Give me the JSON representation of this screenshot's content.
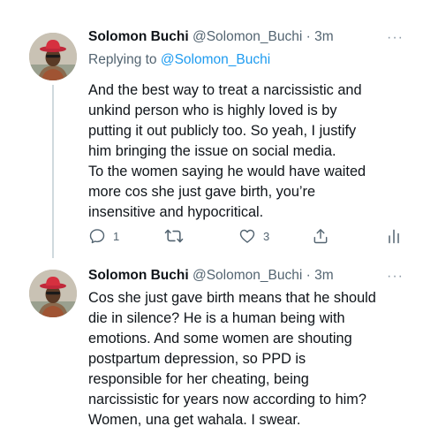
{
  "tweets": [
    {
      "author_name": "Solomon Buchi",
      "handle": "@Solomon_Buchi",
      "separator": "·",
      "time": "3m",
      "more_icon": "more-horizontal-icon",
      "replying_prefix": "Replying to",
      "replying_to": "@Solomon_Buchi",
      "text_lines": [
        "And the best way to treat a narcissistic and",
        "unkind person who is highly loved is by",
        "putting it out publicly too. So yeah, I justify",
        "him bringing the issue on social media.",
        "To the women saying he would have waited",
        "more cos she just gave birth, you’re",
        "insensitive and hypocritical."
      ],
      "actions": {
        "reply_count": "1",
        "retweet_count": "",
        "like_count": "3",
        "icons": [
          "reply-icon",
          "retweet-icon",
          "like-icon",
          "share-icon",
          "analytics-icon"
        ]
      }
    },
    {
      "author_name": "Solomon Buchi",
      "handle": "@Solomon_Buchi",
      "separator": "·",
      "time": "3m",
      "more_icon": "more-horizontal-icon",
      "text_lines": [
        "Cos she just gave birth means that he should",
        "die in silence? He is a human being with",
        "emotions. And some women are shouting",
        "postpartum depression, so PPD is",
        "responsible for her cheating, being",
        "narcissistic for years now according to him?",
        "Women, una get wahala. I swear."
      ]
    }
  ],
  "colors": {
    "text": "#0f1419",
    "secondary": "#536471",
    "link": "#1d9bf0",
    "thread_line": "#cfd9de"
  }
}
